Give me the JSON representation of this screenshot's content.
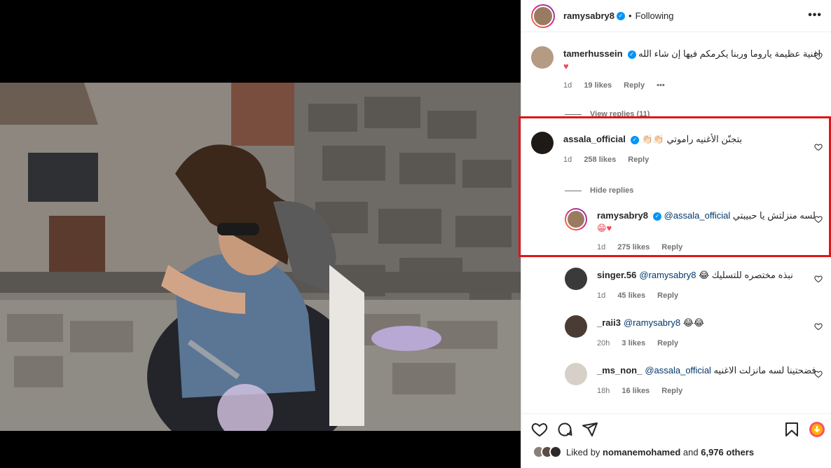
{
  "header": {
    "username": "ramysabry8",
    "separator": "•",
    "follow_status": "Following"
  },
  "comments": [
    {
      "username": "tamerhussein",
      "text": "اغنية عظيمة ياروما وربنا يكرمكم فيها إن شاء الله",
      "emoji": "♥",
      "age": "1d",
      "likes": "19 likes",
      "reply": "Reply",
      "more": "•••",
      "replies_toggle": "View replies (11)"
    },
    {
      "username": "assala_official",
      "text": "بتجنّن الأغنيه راموتي 👏🏻👏🏻",
      "age": "1d",
      "likes": "258 likes",
      "reply": "Reply",
      "replies_toggle": "Hide replies"
    }
  ],
  "replies": [
    {
      "username": "ramysabry8",
      "mention": "@assala_official",
      "text": "لسه منزلتش يا حبيبتي",
      "emoji": "😁♥",
      "age": "1d",
      "likes": "275 likes",
      "reply": "Reply"
    },
    {
      "username": "singer.56",
      "mention": "@ramysabry8",
      "text": "نبذه مختصره للتسليك 😂",
      "age": "1d",
      "likes": "45 likes",
      "reply": "Reply"
    },
    {
      "username": "_raii3",
      "mention": "@ramysabry8",
      "text": "😂😂",
      "age": "20h",
      "likes": "3 likes",
      "reply": "Reply"
    },
    {
      "username": "_ms_non_",
      "mention": "@assala_official",
      "text": "فضحتينا لسه مانزلت الاغنيه",
      "age": "18h",
      "likes": "16 likes",
      "reply": "Reply"
    }
  ],
  "footer": {
    "liked_by_prefix": "Liked by",
    "liked_by_user": "nomanemohamed",
    "and": "and",
    "others": "6,976 others"
  },
  "icons": {
    "heart": "heart-icon",
    "comment": "comment-icon",
    "share": "share-icon",
    "save": "bookmark-icon",
    "download": "download-icon",
    "more": "more-icon"
  },
  "colors": {
    "highlight": "#e0141b",
    "verified": "#0095f6",
    "heart_red": "#ed4956"
  }
}
